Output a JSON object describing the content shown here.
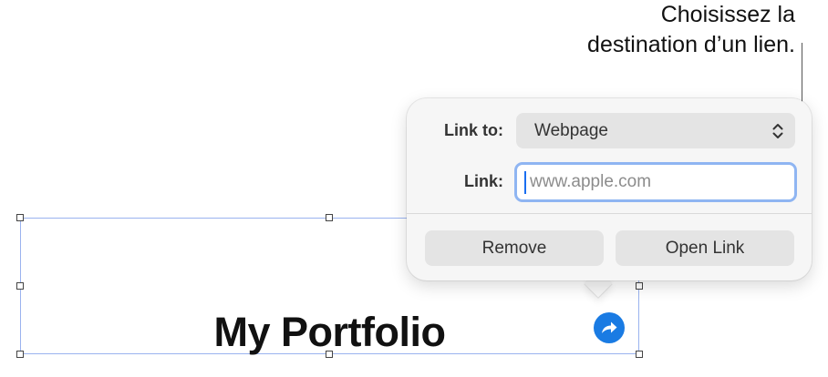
{
  "callout": {
    "line1": "Choisissez la",
    "line2": "destination d’un lien."
  },
  "popover": {
    "link_to_label": "Link to:",
    "link_to_value": "Webpage",
    "link_label": "Link:",
    "link_placeholder": "www.apple.com",
    "remove_label": "Remove",
    "open_link_label": "Open Link"
  },
  "canvas": {
    "title": "My Portfolio"
  },
  "icons": {
    "select": "chevron-up-down-icon",
    "link_badge": "link-arrow-icon"
  },
  "colors": {
    "accent": "#1a7be3",
    "selection_border": "#9ab3ef",
    "focus_ring": "#8fb5f2"
  }
}
